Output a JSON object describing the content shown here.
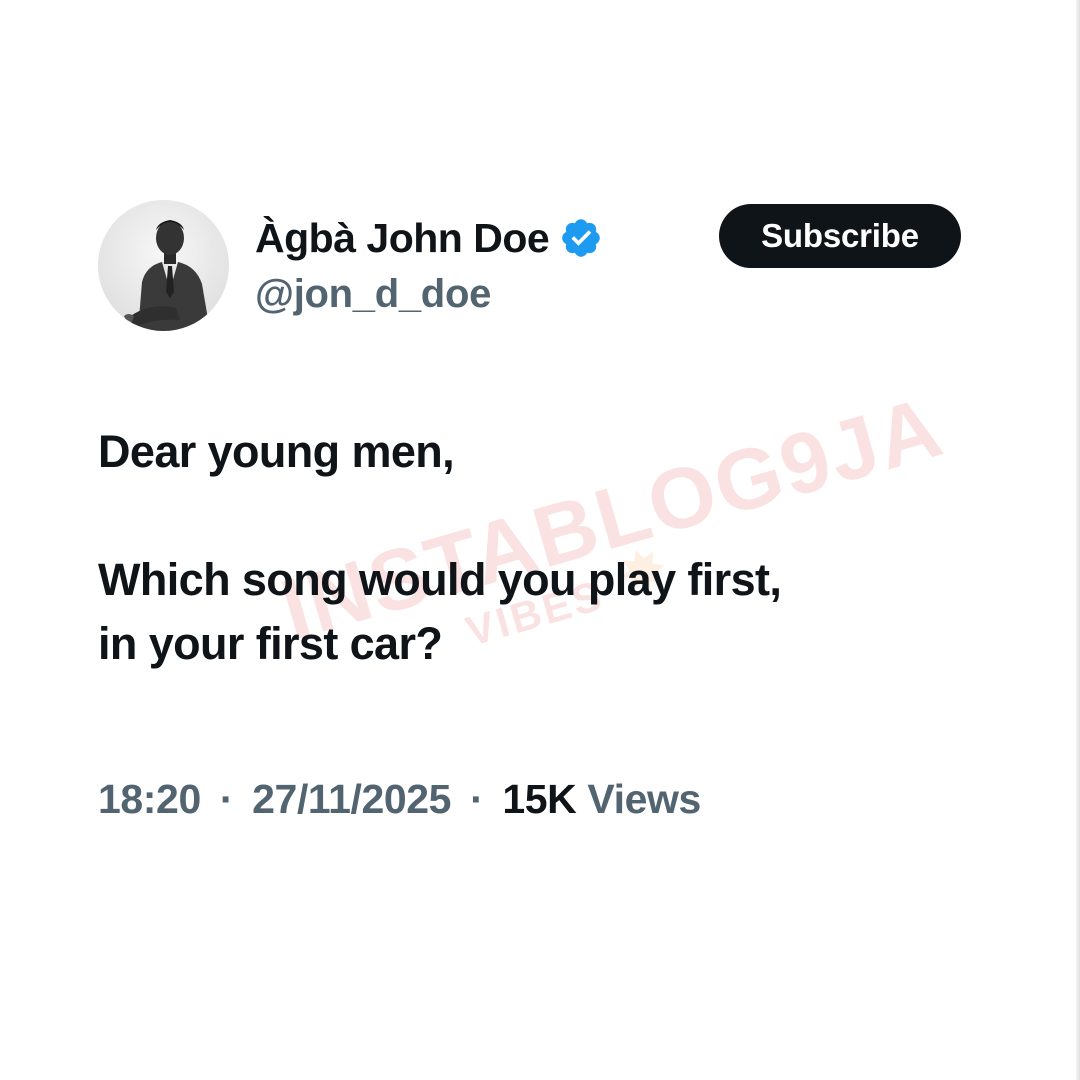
{
  "tweet": {
    "author": {
      "display_name": "Àgbà John Doe",
      "handle": "@jon_d_doe",
      "verified": true,
      "avatar_icon": "profile-photo-man-in-suit"
    },
    "subscribe_label": "Subscribe",
    "body": {
      "line1": "Dear young men,",
      "line2": "Which song would you play first,",
      "line3": "in your first car?"
    },
    "meta": {
      "time": "18:20",
      "date": "27/11/2025",
      "separator": "·",
      "views_count": "15K",
      "views_label": "Views"
    }
  },
  "watermark": {
    "text": "INSTABLOG9JA",
    "subtext": "VIBES",
    "color": "#e0262b"
  },
  "colors": {
    "text_primary": "#0f1419",
    "text_secondary": "#536471",
    "verified_blue": "#1d9bf0",
    "button_bg": "#0f1419",
    "background": "#ffffff"
  }
}
